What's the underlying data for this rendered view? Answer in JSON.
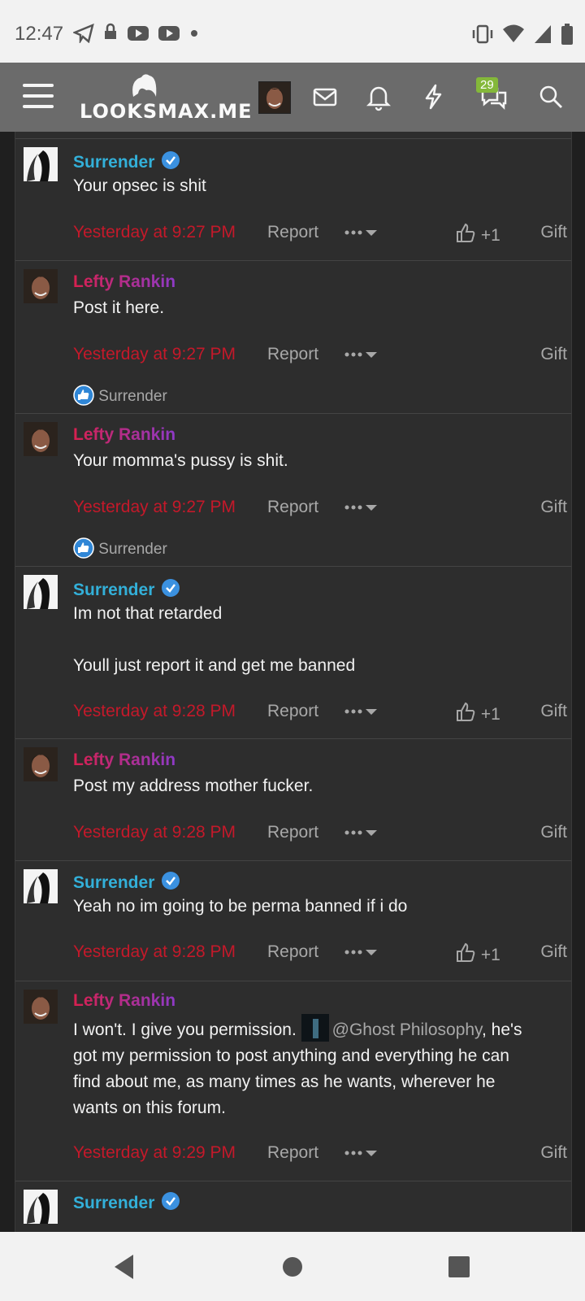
{
  "status_bar": {
    "time": "12:47"
  },
  "header": {
    "logo": "LOOKSMAX.ME",
    "chat_badge": "29"
  },
  "posts": [
    {
      "author": "Surrender",
      "type": "sur",
      "verified": true,
      "lines": [
        "Your opsec is shit"
      ],
      "time": "Yesterday at 9:27 PM",
      "report": "Report",
      "like": "+1",
      "gift": "Gift",
      "reaction": ""
    },
    {
      "author": "Lefty Rankin",
      "type": "lefty",
      "verified": false,
      "lines": [
        "Post it here."
      ],
      "time": "Yesterday at 9:27 PM",
      "report": "Report",
      "like": "",
      "gift": "Gift",
      "reaction": "Surrender"
    },
    {
      "author": "Lefty Rankin",
      "type": "lefty",
      "verified": false,
      "lines": [
        "Your momma's pussy is shit."
      ],
      "time": "Yesterday at 9:27 PM",
      "report": "Report",
      "like": "",
      "gift": "Gift",
      "reaction": "Surrender"
    },
    {
      "author": "Surrender",
      "type": "sur",
      "verified": true,
      "lines": [
        "Im not that retarded",
        "",
        "Youll just report it and get me banned"
      ],
      "time": "Yesterday at 9:28 PM",
      "report": "Report",
      "like": "+1",
      "gift": "Gift",
      "reaction": ""
    },
    {
      "author": "Lefty Rankin",
      "type": "lefty",
      "verified": false,
      "lines": [
        "Post my address mother fucker."
      ],
      "time": "Yesterday at 9:28 PM",
      "report": "Report",
      "like": "",
      "gift": "Gift",
      "reaction": ""
    },
    {
      "author": "Surrender",
      "type": "sur",
      "verified": true,
      "lines": [
        "Yeah no im going to be perma banned if i do"
      ],
      "time": "Yesterday at 9:28 PM",
      "report": "Report",
      "like": "+1",
      "gift": "Gift",
      "reaction": ""
    },
    {
      "author": "Lefty Rankin",
      "type": "lefty",
      "verified": false,
      "lines": [],
      "time": "Yesterday at 9:29 PM",
      "report": "Report",
      "like": "",
      "gift": "Gift",
      "reaction": ""
    },
    {
      "author": "Surrender",
      "type": "sur",
      "verified": true,
      "lines": [],
      "time": "",
      "report": "",
      "like": "",
      "gift": "",
      "reaction": ""
    }
  ],
  "mention_post": {
    "before": "I won't. I give you permission. ",
    "mention": "@Ghost Philosophy",
    "after": ", he's",
    "rest_lines": [
      "got my permission to post anything and everything he can",
      "find about me, as many times as he wants, wherever he",
      "wants on this forum."
    ]
  },
  "colors": {
    "time_red": "#c4192a",
    "surrender_blue": "#33b0d9",
    "badge_green": "#84b83a"
  },
  "icons": [
    "menu-icon",
    "mail-icon",
    "bell-icon",
    "bolt-icon",
    "chat-icon",
    "search-icon",
    "verified-icon",
    "thumbs-up-icon",
    "more-icon",
    "caret-down-icon",
    "like-reaction-icon",
    "back-icon",
    "home-icon",
    "recents-icon"
  ]
}
